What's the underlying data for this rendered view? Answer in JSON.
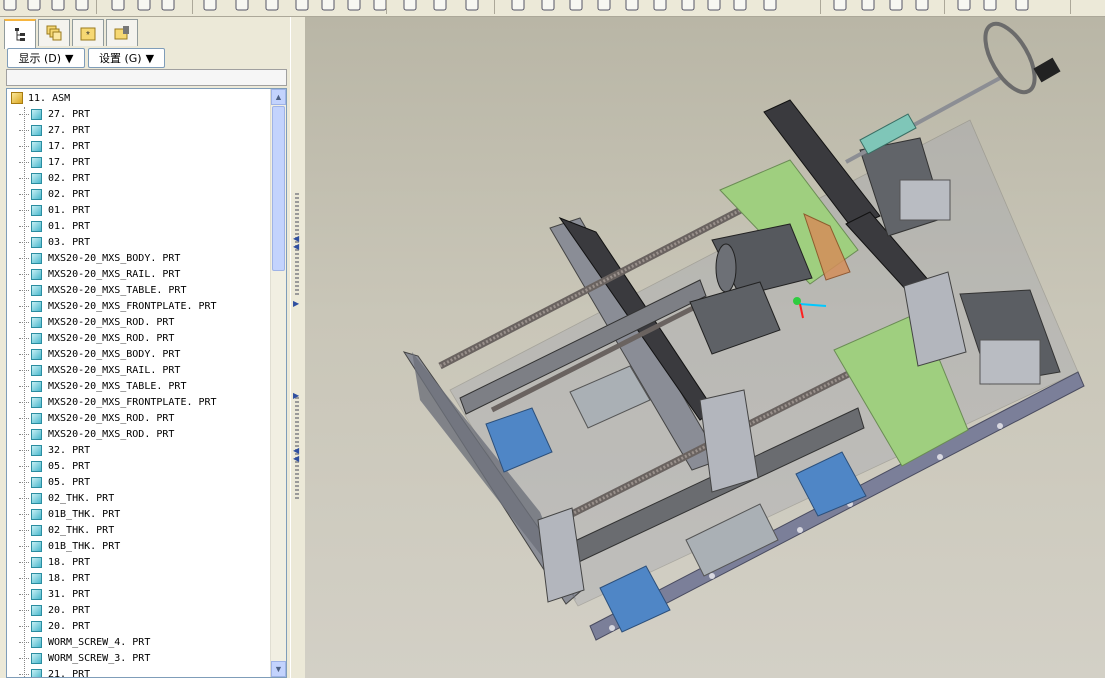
{
  "toolbar": {
    "icons": [
      "new-icon",
      "open-icon",
      "save-icon",
      "print-icon",
      "send-icon",
      "email-icon",
      "undo-icon",
      "redo-icon",
      "cut-icon",
      "copy-icon",
      "paste-icon",
      "regenerate-icon",
      "model-tree-icon",
      "window-icon",
      "layers-icon",
      "repaint-icon",
      "spin-center-icon",
      "orient-icon",
      "pan-icon",
      "zoom-in-icon",
      "zoom-out-icon",
      "refit-icon",
      "named-view-icon",
      "view-manager-icon",
      "saved-views-icon",
      "wireframe-icon",
      "hidden-line-icon",
      "no-hidden-icon",
      "shading-icon",
      "datum-planes-icon",
      "datum-axes-icon",
      "datum-points-icon",
      "coordsys-icon",
      "annotations-icon"
    ]
  },
  "panel": {
    "tabs": [
      "model-tree-tab",
      "layer-tree-tab",
      "favorites-tab",
      "folder-tab"
    ],
    "show_button": "显示 (D)",
    "settings_button": "设置 (G)"
  },
  "tree": {
    "root": "11. ASM",
    "items": [
      "27. PRT",
      "27. PRT",
      "17. PRT",
      "17. PRT",
      "02. PRT",
      "02. PRT",
      "01. PRT",
      "01. PRT",
      "03. PRT",
      "MXS20-20_MXS_BODY. PRT",
      "MXS20-20_MXS_RAIL. PRT",
      "MXS20-20_MXS_TABLE. PRT",
      "MXS20-20_MXS_FRONTPLATE. PRT",
      "MXS20-20_MXS_ROD. PRT",
      "MXS20-20_MXS_ROD. PRT",
      "MXS20-20_MXS_BODY. PRT",
      "MXS20-20_MXS_RAIL. PRT",
      "MXS20-20_MXS_TABLE. PRT",
      "MXS20-20_MXS_FRONTPLATE. PRT",
      "MXS20-20_MXS_ROD. PRT",
      "MXS20-20_MXS_ROD. PRT",
      "32. PRT",
      "05. PRT",
      "05. PRT",
      "02_THK. PRT",
      "01B_THK. PRT",
      "02_THK. PRT",
      "01B_THK. PRT",
      "18. PRT",
      "18. PRT",
      "31. PRT",
      "20. PRT",
      "20. PRT",
      "WORM_SCREW_4. PRT",
      "WORM_SCREW_3. PRT",
      "21. PRT"
    ]
  },
  "colors": {
    "viewport_bg": "#c9c6b8",
    "accent": "#f6b53f"
  }
}
